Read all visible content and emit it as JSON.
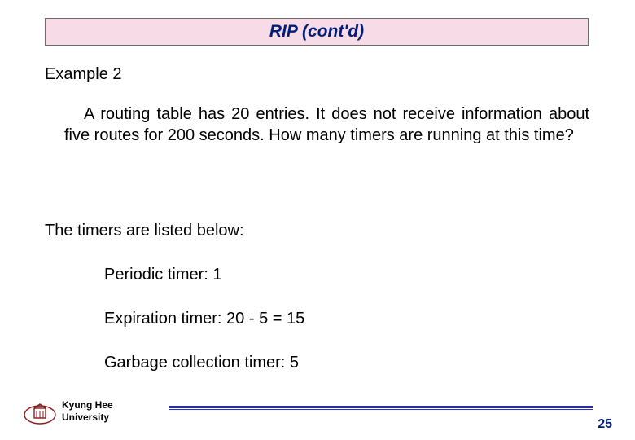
{
  "title": "RIP (cont'd)",
  "example_label": "Example 2",
  "question": "A routing table has 20 entries. It does not receive information about five routes for 200 seconds. How many timers are running at this time?",
  "answer_intro": "The timers are listed below:",
  "timers": {
    "periodic": "Periodic timer: 1",
    "expiration": "Expiration timer: 20 - 5 = 15",
    "garbage": "Garbage collection timer: 5"
  },
  "footer": {
    "university_line1": "Kyung Hee",
    "university_line2": "University",
    "page": "25"
  },
  "colors": {
    "title_bg": "#f7dbe6",
    "title_fg": "#001f7a",
    "rule": "#2a2fb5"
  }
}
